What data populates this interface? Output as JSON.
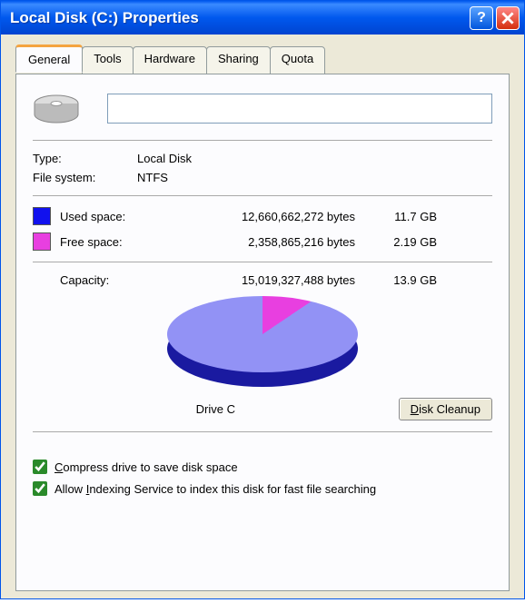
{
  "title": "Local Disk (C:) Properties",
  "tabs": {
    "general": "General",
    "tools": "Tools",
    "hardware": "Hardware",
    "sharing": "Sharing",
    "quota": "Quota"
  },
  "drive_name": "",
  "type_label": "Type:",
  "type_value": "Local Disk",
  "fs_label": "File system:",
  "fs_value": "NTFS",
  "used": {
    "label": "Used space:",
    "bytes": "12,660,662,272 bytes",
    "gb": "11.7 GB"
  },
  "free": {
    "label": "Free space:",
    "bytes": "2,358,865,216 bytes",
    "gb": "2.19 GB"
  },
  "capacity": {
    "label": "Capacity:",
    "bytes": "15,019,327,488 bytes",
    "gb": "13.9 GB"
  },
  "drive_label": "Drive C",
  "cleanup_btn": "Disk Cleanup",
  "compress_label": "Compress drive to save disk space",
  "indexing_label": "Allow Indexing Service to index this disk for fast file searching",
  "chart_data": {
    "type": "pie",
    "title": "Drive C",
    "series": [
      {
        "name": "Used space",
        "value": 12660662272,
        "gb": 11.7,
        "color": "#1111ee"
      },
      {
        "name": "Free space",
        "value": 2358865216,
        "gb": 2.19,
        "color": "#e83fe0"
      }
    ],
    "total": 15019327488
  }
}
